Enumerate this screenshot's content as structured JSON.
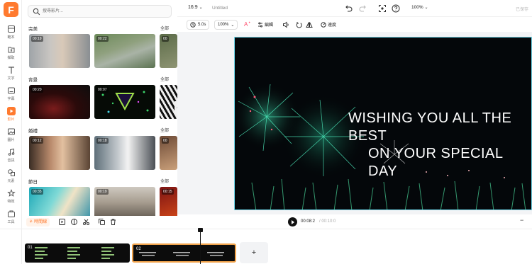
{
  "brand": {
    "logo_letter": "F",
    "accent": "#ff7a2f"
  },
  "rail": [
    {
      "name": "template",
      "label": "範本",
      "icon": "template-icon"
    },
    {
      "name": "upload",
      "label": "擷取",
      "icon": "upload-icon"
    },
    {
      "name": "text",
      "label": "文字",
      "icon": "text-icon"
    },
    {
      "name": "subtitle",
      "label": "字幕",
      "icon": "subtitle-icon"
    },
    {
      "name": "video",
      "label": "影片",
      "icon": "video-icon",
      "active": true
    },
    {
      "name": "image",
      "label": "圖片",
      "icon": "image-icon"
    },
    {
      "name": "audio",
      "label": "音訊",
      "icon": "audio-icon"
    },
    {
      "name": "elements",
      "label": "元素",
      "icon": "elements-icon"
    },
    {
      "name": "effects",
      "label": "特效",
      "icon": "effects-icon"
    },
    {
      "name": "tools",
      "label": "工具",
      "icon": "tools-icon"
    }
  ],
  "search": {
    "placeholder": "搜尋影片..."
  },
  "sections": [
    {
      "title": "完美",
      "all": "全部",
      "durations": [
        "00:19",
        "00:22",
        "00"
      ]
    },
    {
      "title": "背景",
      "all": "全部",
      "durations": [
        "00:20",
        "00:07",
        ""
      ]
    },
    {
      "title": "婚禮",
      "all": "全部",
      "durations": [
        "00:12",
        "00:18",
        "00"
      ]
    },
    {
      "title": "節日",
      "all": "全部",
      "durations": [
        "00:35",
        "00:19",
        "00:15"
      ]
    }
  ],
  "topbar": {
    "aspect": "16:9",
    "doc_title": "Untitled",
    "zoom": "100%",
    "export": "已保存"
  },
  "toolbar": {
    "duration": "5.0s",
    "zoom": "100%",
    "edit": "編輯",
    "speed": "速度"
  },
  "video_text": [
    "WISHING YOU ALL THE BEST",
    "ON YOUR SPECIAL DAY"
  ],
  "player": {
    "current": "00:08:2",
    "total": "/ 00:10:0"
  },
  "timeline": {
    "label": "時間線",
    "clips": [
      {
        "num": "01"
      },
      {
        "num": "02"
      }
    ],
    "add": "+"
  },
  "colors": {
    "selection": "#6fd6e8",
    "clip_border": "#f0a24a"
  }
}
